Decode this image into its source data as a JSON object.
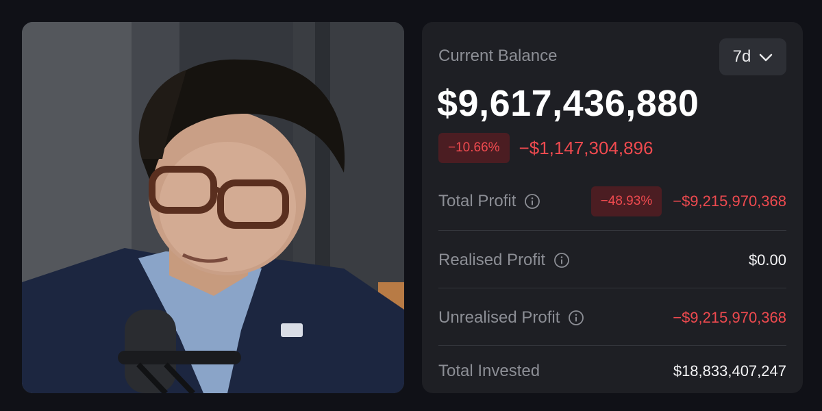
{
  "balance_card": {
    "label": "Current Balance",
    "range": "7d",
    "balance": "$9,617,436,880",
    "change_percent": "−10.66%",
    "change_amount": "−$1,147,304,896"
  },
  "metrics": {
    "total_profit": {
      "label": "Total Profit",
      "percent": "−48.93%",
      "value": "−$9,215,970,368"
    },
    "realised_profit": {
      "label": "Realised Profit",
      "value": "$0.00"
    },
    "unrealised_profit": {
      "label": "Unrealised Profit",
      "value": "−$9,215,970,368"
    },
    "total_invested": {
      "label": "Total Invested",
      "value": "$18,833,407,247"
    }
  },
  "colors": {
    "background": "#101117",
    "card": "#1e1f24",
    "negative": "#ef4a4f",
    "negative_badge": "#4b1d22",
    "muted_text": "#8c8e95"
  },
  "icons": {
    "dropdown": "chevron-down-icon",
    "info": "info-icon"
  }
}
